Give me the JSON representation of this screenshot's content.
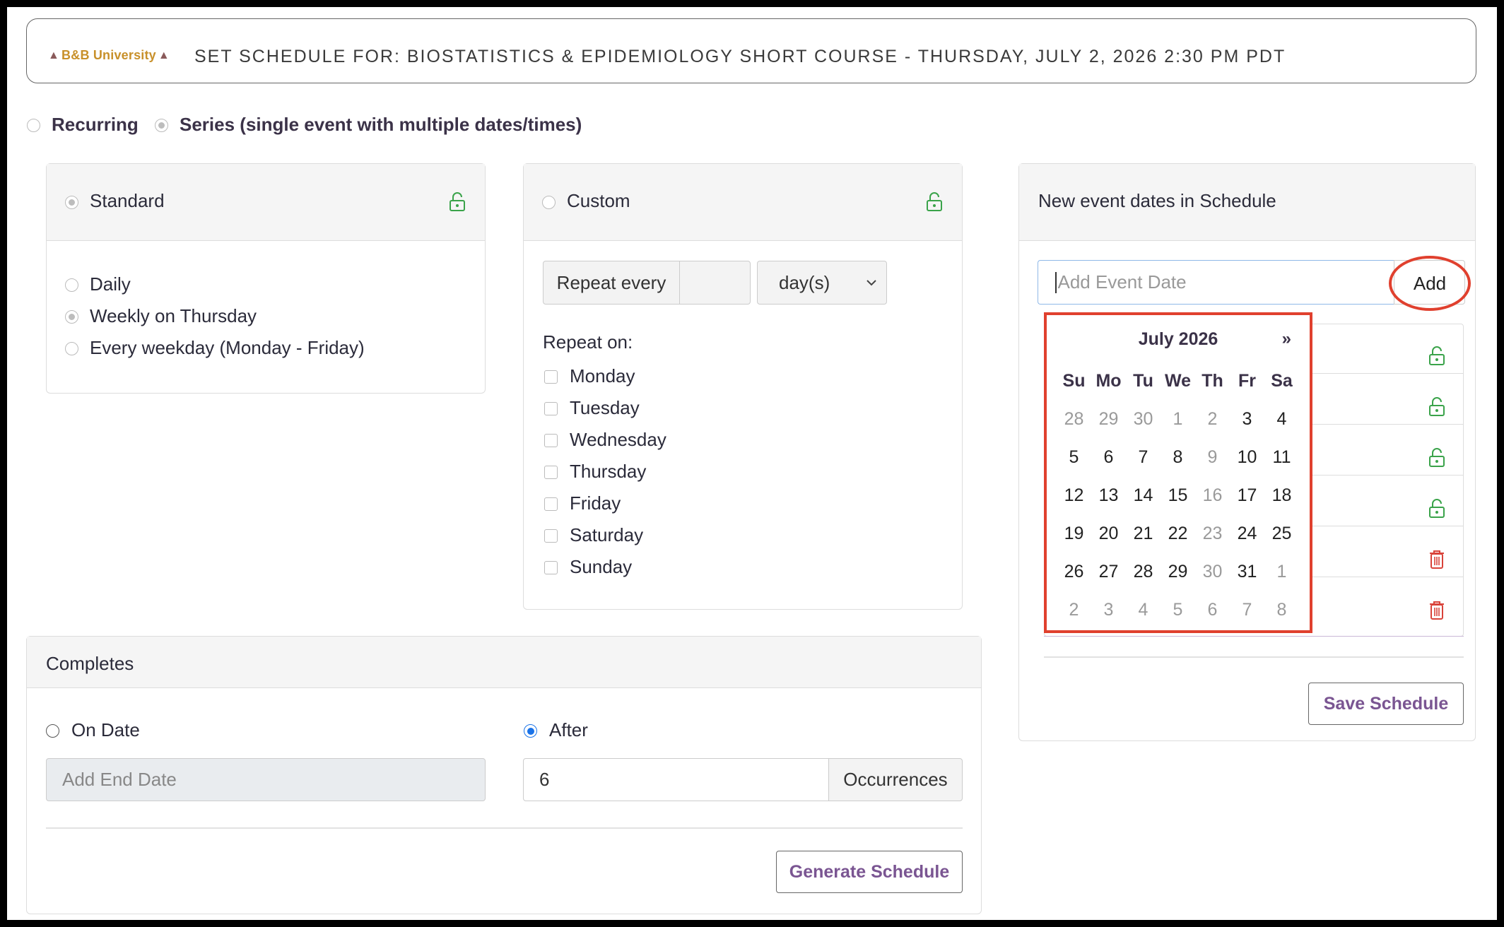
{
  "header": {
    "logo_text": "B&B University",
    "title": "SET SCHEDULE FOR: BIOSTATISTICS & EPIDEMIOLOGY SHORT COURSE - THURSDAY, JULY 2, 2026 2:30 PM PDT"
  },
  "mode": {
    "recurring_label": "Recurring",
    "series_label": "Series (single event with multiple dates/times)"
  },
  "standard": {
    "label": "Standard",
    "options": [
      "Daily",
      "Weekly on Thursday",
      "Every weekday (Monday - Friday)"
    ]
  },
  "custom": {
    "label": "Custom",
    "repeat_every_label": "Repeat every",
    "repeat_every_value": "",
    "unit_selected": "day(s)",
    "repeat_on_label": "Repeat on:",
    "days": [
      "Monday",
      "Tuesday",
      "Wednesday",
      "Thursday",
      "Friday",
      "Saturday",
      "Sunday"
    ]
  },
  "completes": {
    "title": "Completes",
    "on_date_label": "On Date",
    "end_date_placeholder": "Add End Date",
    "after_label": "After",
    "occurrences_value": "6",
    "occurrences_label": "Occurrences",
    "generate_button": "Generate Schedule"
  },
  "event_dates": {
    "title": "New event dates in Schedule",
    "add_placeholder": "Add Event Date",
    "add_button": "Add",
    "save_button": "Save Schedule"
  },
  "calendar": {
    "month_label": "July 2026",
    "next_label": "»",
    "weekdays": [
      "Su",
      "Mo",
      "Tu",
      "We",
      "Th",
      "Fr",
      "Sa"
    ],
    "weeks": [
      [
        "28",
        "29",
        "30",
        "1",
        "2",
        "3",
        "4"
      ],
      [
        "5",
        "6",
        "7",
        "8",
        "9",
        "10",
        "11"
      ],
      [
        "12",
        "13",
        "14",
        "15",
        "16",
        "17",
        "18"
      ],
      [
        "19",
        "20",
        "21",
        "22",
        "23",
        "24",
        "25"
      ],
      [
        "26",
        "27",
        "28",
        "29",
        "30",
        "31",
        "1"
      ],
      [
        "2",
        "3",
        "4",
        "5",
        "6",
        "7",
        "8"
      ]
    ],
    "muted": [
      [
        true,
        true,
        true,
        true,
        true,
        false,
        false
      ],
      [
        false,
        false,
        false,
        false,
        true,
        false,
        false
      ],
      [
        false,
        false,
        false,
        false,
        true,
        false,
        false
      ],
      [
        false,
        false,
        false,
        false,
        true,
        false,
        false
      ],
      [
        false,
        false,
        false,
        false,
        true,
        false,
        true
      ],
      [
        true,
        true,
        true,
        true,
        true,
        true,
        true
      ]
    ]
  },
  "colors": {
    "accent_purple": "#7a5592",
    "highlight_red": "#e0402e",
    "lock_green": "#3aa34a",
    "trash_red": "#d9433a",
    "radio_blue": "#1a73e8"
  }
}
